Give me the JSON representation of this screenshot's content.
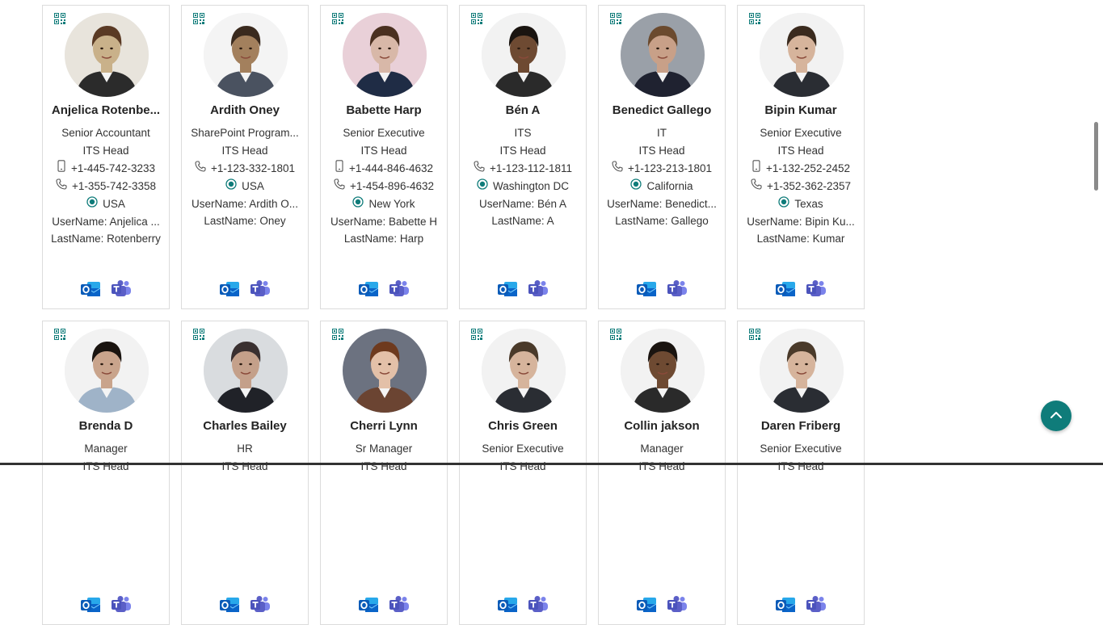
{
  "people": [
    {
      "name": "Anjelica Rotenbe...",
      "title": "Senior Accountant",
      "dept": "ITS Head",
      "mobile": "+1-445-742-3233",
      "phone": "+1-355-742-3358",
      "location": "USA",
      "username": "UserName: Anjelica ...",
      "lastname": "LastName: Rotenberry",
      "tone": "#c9b18a"
    },
    {
      "name": "Ardith Oney",
      "title": "SharePoint Program...",
      "dept": "ITS Head",
      "phone": "+1-123-332-1801",
      "location": "USA",
      "username": "UserName: Ardith O...",
      "lastname": "LastName: Oney",
      "tone": "#a3805d"
    },
    {
      "name": "Babette Harp",
      "title": "Senior Executive",
      "dept": "ITS Head",
      "mobile": "+1-444-846-4632",
      "phone": "+1-454-896-4632",
      "location": "New York",
      "username": "UserName: Babette H",
      "lastname": "LastName: Harp",
      "tone": "#d8b8a8"
    },
    {
      "name": "Bén A",
      "title": "ITS",
      "dept": "ITS Head",
      "phone": "+1-123-112-1811",
      "location": "Washington DC",
      "username": "UserName: Bén A",
      "lastname": "LastName: A",
      "tone": "#6e4a32"
    },
    {
      "name": "Benedict Gallego",
      "title": "IT",
      "dept": "ITS Head",
      "phone": "+1-123-213-1801",
      "location": "California",
      "username": "UserName: Benedict...",
      "lastname": "LastName: Gallego",
      "tone": "#c8a088"
    },
    {
      "name": "Bipin Kumar",
      "title": "Senior Executive",
      "dept": "ITS Head",
      "mobile": "+1-132-252-2452",
      "phone": "+1-352-362-2357",
      "location": "Texas",
      "username": "UserName: Bipin Ku...",
      "lastname": "LastName: Kumar",
      "tone": "#d6b49c"
    },
    {
      "name": "Brenda D",
      "title": "Manager",
      "dept": "ITS Head",
      "tone": "#c9a48c"
    },
    {
      "name": "Charles Bailey",
      "title": "HR",
      "dept": "ITS Head",
      "tone": "#c4a08a"
    },
    {
      "name": "Cherri Lynn",
      "title": "Sr Manager",
      "dept": "ITS Head",
      "tone": "#e3c0a8"
    },
    {
      "name": "Chris Green",
      "title": "Senior Executive",
      "dept": "ITS Head",
      "tone": "#d6b49c"
    },
    {
      "name": "Collin jakson",
      "title": "Manager",
      "dept": "ITS Head",
      "tone": "#6e4a32"
    },
    {
      "name": "Daren Friberg",
      "title": "Senior Executive",
      "dept": "ITS Head",
      "tone": "#d6b49c"
    }
  ],
  "icons": {
    "qr": "qr-code-icon",
    "mobile": "mobile-phone-icon",
    "phone": "phone-icon",
    "location": "location-icon",
    "outlook": "outlook-icon",
    "teams": "teams-icon",
    "up": "arrow-up-icon"
  },
  "colors": {
    "accent": "#0f7c7a",
    "outlook": "#0a64c8",
    "teams": "#5b5fc7"
  }
}
